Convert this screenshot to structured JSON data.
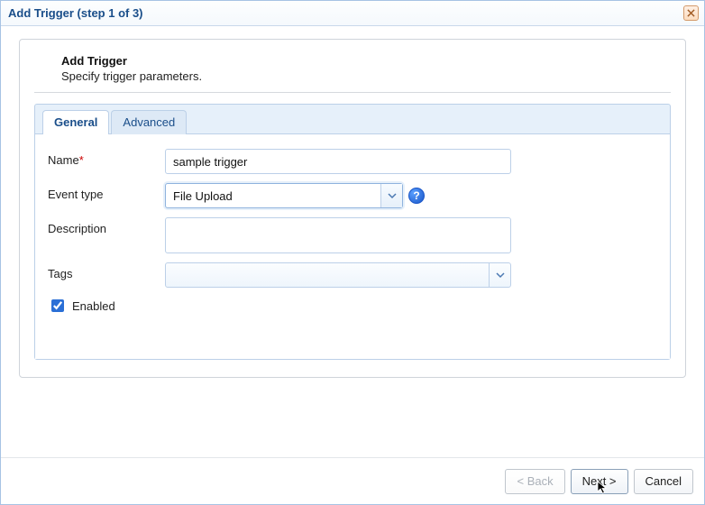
{
  "dialog": {
    "title": "Add Trigger (step 1 of 3)"
  },
  "panel": {
    "title": "Add Trigger",
    "subtitle": "Specify trigger parameters."
  },
  "tabs": {
    "general": "General",
    "advanced": "Advanced"
  },
  "labels": {
    "name": "Name",
    "event_type": "Event type",
    "description": "Description",
    "tags": "Tags",
    "enabled": "Enabled"
  },
  "required_marker": "*",
  "values": {
    "name": "sample trigger",
    "event_type": "File Upload",
    "description": "",
    "tags": "",
    "enabled": true
  },
  "help_glyph": "?",
  "buttons": {
    "back": "< Back",
    "next": "Next >",
    "cancel": "Cancel"
  }
}
